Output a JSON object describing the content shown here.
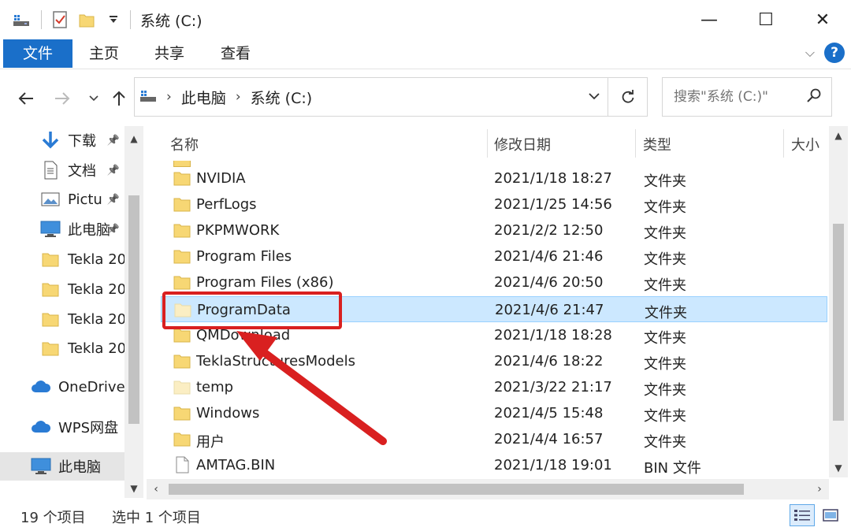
{
  "window": {
    "title": "系统 (C:)",
    "controls": {
      "minimize": "—",
      "maximize": "☐",
      "close": "✕"
    }
  },
  "ribbon": {
    "tabs": [
      {
        "label": "文件",
        "active": true
      },
      {
        "label": "主页"
      },
      {
        "label": "共享"
      },
      {
        "label": "查看"
      }
    ],
    "help": "?"
  },
  "nav": {
    "breadcrumbs": [
      "此电脑",
      "系统 (C:)"
    ],
    "search_placeholder": "搜索\"系统 (C:)\""
  },
  "sidebar": {
    "items": [
      {
        "label": "下载",
        "icon": "download-arrow-icon",
        "pinned": true
      },
      {
        "label": "文档",
        "icon": "document-icon",
        "pinned": true
      },
      {
        "label": "Pictu",
        "icon": "picture-icon",
        "pinned": true
      },
      {
        "label": "此电脑",
        "icon": "computer-icon",
        "pinned": true
      },
      {
        "label": "Tekla 20",
        "icon": "folder-icon"
      },
      {
        "label": "Tekla 20",
        "icon": "folder-icon"
      },
      {
        "label": "Tekla 20",
        "icon": "folder-icon"
      },
      {
        "label": "Tekla 20",
        "icon": "folder-icon"
      },
      {
        "label": "OneDrive",
        "icon": "cloud-icon"
      },
      {
        "label": "WPS网盘",
        "icon": "cloud-icon"
      },
      {
        "label": "此电脑",
        "icon": "computer-icon",
        "selected": true
      }
    ]
  },
  "columns": {
    "name": "名称",
    "date": "修改日期",
    "type": "类型",
    "size": "大小"
  },
  "files": [
    {
      "name": "NVIDIA",
      "date": "2021/1/18 18:27",
      "type": "文件夹",
      "kind": "folder"
    },
    {
      "name": "PerfLogs",
      "date": "2021/1/25 14:56",
      "type": "文件夹",
      "kind": "folder"
    },
    {
      "name": "PKPMWORK",
      "date": "2021/2/2 12:50",
      "type": "文件夹",
      "kind": "folder"
    },
    {
      "name": "Program Files",
      "date": "2021/4/6 21:46",
      "type": "文件夹",
      "kind": "folder"
    },
    {
      "name": "Program Files (x86)",
      "date": "2021/4/6 20:50",
      "type": "文件夹",
      "kind": "folder"
    },
    {
      "name": "ProgramData",
      "date": "2021/4/6 21:47",
      "type": "文件夹",
      "kind": "folder-hidden",
      "selected": true
    },
    {
      "name": "QMDownload",
      "date": "2021/1/18 18:28",
      "type": "文件夹",
      "kind": "folder"
    },
    {
      "name": "TeklaStructuresModels",
      "date": "2021/4/6 18:22",
      "type": "文件夹",
      "kind": "folder"
    },
    {
      "name": "temp",
      "date": "2021/3/22 21:17",
      "type": "文件夹",
      "kind": "folder-hidden"
    },
    {
      "name": "Windows",
      "date": "2021/4/5 15:48",
      "type": "文件夹",
      "kind": "folder"
    },
    {
      "name": "用户",
      "date": "2021/4/4 16:57",
      "type": "文件夹",
      "kind": "folder"
    },
    {
      "name": "AMTAG.BIN",
      "date": "2021/1/18 19:01",
      "type": "BIN 文件",
      "kind": "file"
    }
  ],
  "status": {
    "item_count": "19 个项目",
    "selection": "选中 1 个项目"
  },
  "colors": {
    "accent": "#1a6fc9",
    "selection": "#cce8ff",
    "annotation": "#d92020",
    "folder": "#f7d774"
  }
}
